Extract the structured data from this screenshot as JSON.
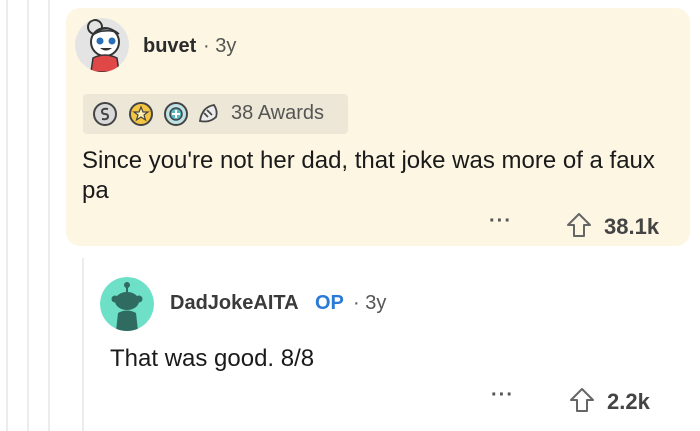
{
  "comments": [
    {
      "author": "buvet",
      "separator": "·",
      "age": "3y",
      "awards_label": "38 Awards",
      "body": "Since you're not her dad, that joke was more of a faux pa",
      "more": "···",
      "score": "38.1k",
      "icons": [
        "avatar",
        "silver-award-icon",
        "gold-award-icon",
        "helpful-award-icon",
        "wholesome-award-icon",
        "upvote-icon"
      ]
    },
    {
      "author": "DadJokeAITA",
      "op_badge": "OP",
      "separator": "·",
      "age": "3y",
      "body": "That was good. 8/8",
      "more": "···",
      "score": "2.2k",
      "icons": [
        "avatar",
        "upvote-icon"
      ]
    }
  ],
  "colors": {
    "card_background": "#fcf6e3",
    "op_badge": "#2a7ad6",
    "op_avatar_background": "#6fe0c8"
  }
}
